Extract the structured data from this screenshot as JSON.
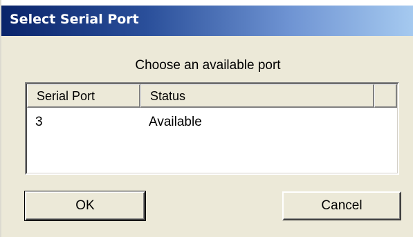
{
  "window": {
    "title": "Select Serial Port"
  },
  "prompt": "Choose an available port",
  "table": {
    "columns": [
      "Serial Port",
      "Status",
      ""
    ],
    "rows": [
      {
        "port": "3",
        "status": "Available"
      }
    ]
  },
  "buttons": {
    "ok": "OK",
    "cancel": "Cancel"
  }
}
